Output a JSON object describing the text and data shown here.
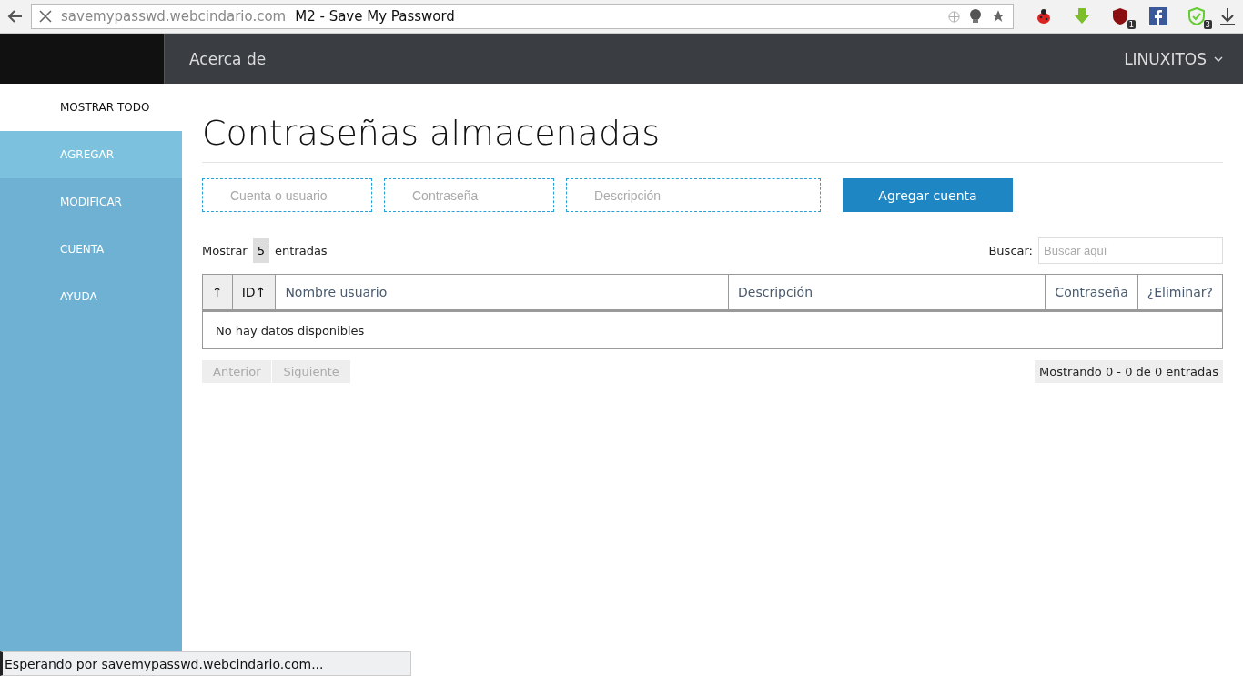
{
  "browser": {
    "url_host": "savemypasswd.webcindario.com",
    "page_title": "M2 - Save My Password",
    "extension_badges": [
      {
        "kind": "bug"
      },
      {
        "kind": "download"
      },
      {
        "kind": "shield",
        "badge": "1"
      },
      {
        "kind": "facebook"
      },
      {
        "kind": "check-shield",
        "badge": "3"
      }
    ]
  },
  "navbar": {
    "link": "Acerca de",
    "user": "LINUXITOS"
  },
  "sidebar": {
    "top_link": "MOSTRAR TODO",
    "items": [
      {
        "label": "AGREGAR",
        "selected": true
      },
      {
        "label": "MODIFICAR",
        "selected": false
      },
      {
        "label": "CUENTA",
        "selected": false
      },
      {
        "label": "AYUDA",
        "selected": false
      }
    ]
  },
  "main": {
    "title": "Contraseñas almacenadas",
    "form": {
      "fields": [
        {
          "placeholder": "Cuenta o usuario"
        },
        {
          "placeholder": "Contraseña"
        },
        {
          "placeholder": "Descripción"
        }
      ],
      "button": "Agregar cuenta"
    },
    "length": {
      "before": "Mostrar",
      "value": "5",
      "after": "entradas"
    },
    "search": {
      "label": "Buscar:",
      "placeholder": "Buscar aquí"
    },
    "table": {
      "columns": [
        {
          "label": "↑",
          "sorted": true
        },
        {
          "label": "ID",
          "sort": "↑",
          "sorted": true
        },
        {
          "label": "Nombre usuario",
          "sorted": false
        },
        {
          "label": "Descripción",
          "sorted": false
        },
        {
          "label": "Contraseña",
          "sorted": false
        },
        {
          "label": "¿Eliminar?",
          "sorted": false
        }
      ],
      "empty": "No hay datos disponibles"
    },
    "pager": {
      "buttons": [
        {
          "label": "Anterior",
          "disabled": true
        },
        {
          "label": "Siguiente",
          "disabled": true
        }
      ],
      "info": "Mostrando 0 - 0 de 0 entradas"
    }
  },
  "status_bar": "Esperando por savemypasswd.webcindario.com..."
}
